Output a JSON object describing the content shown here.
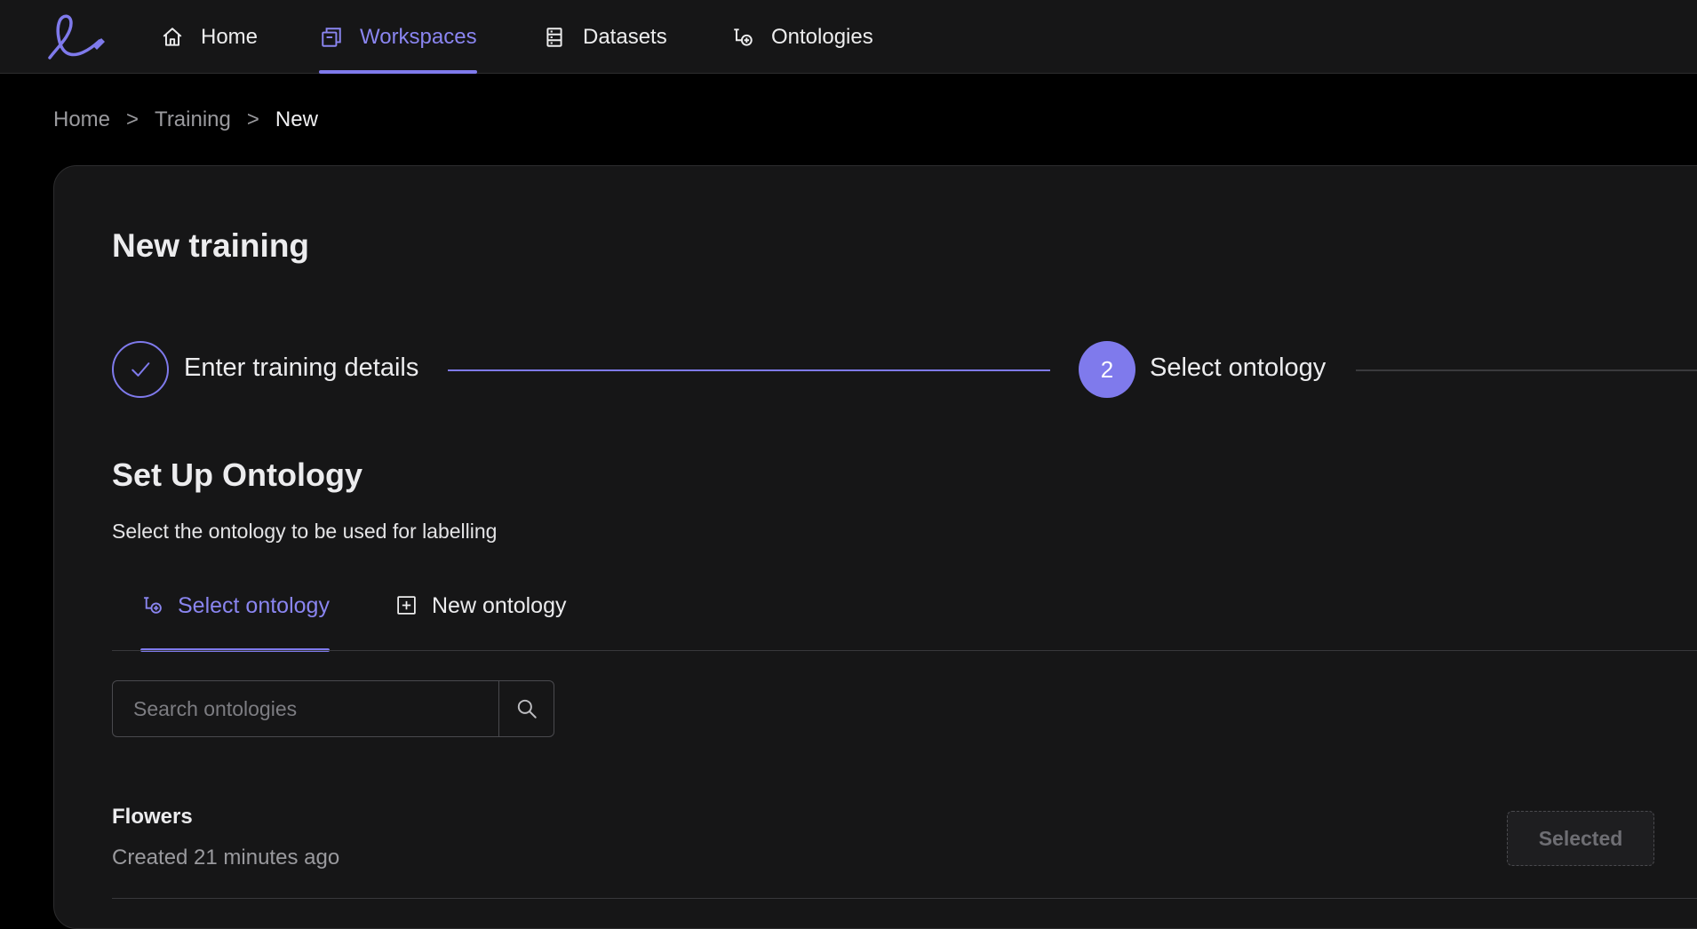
{
  "nav": {
    "items": [
      {
        "label": "Home",
        "icon": "home-icon",
        "active": false
      },
      {
        "label": "Workspaces",
        "icon": "workspaces-icon",
        "active": true
      },
      {
        "label": "Datasets",
        "icon": "datasets-icon",
        "active": false
      },
      {
        "label": "Ontologies",
        "icon": "ontologies-icon",
        "active": false
      }
    ]
  },
  "breadcrumb": {
    "items": [
      "Home",
      "Training",
      "New"
    ],
    "separator": ">"
  },
  "page": {
    "title": "New training"
  },
  "stepper": {
    "steps": [
      {
        "label": "Enter training details",
        "state": "done",
        "icon": "check-icon"
      },
      {
        "number": "2",
        "label": "Select ontology",
        "state": "active"
      }
    ]
  },
  "section": {
    "title": "Set Up Ontology",
    "subtitle": "Select the ontology to be used for labelling"
  },
  "tabs": [
    {
      "label": "Select ontology",
      "icon": "ontologies-icon",
      "active": true
    },
    {
      "label": "New ontology",
      "icon": "plus-square-icon",
      "active": false
    }
  ],
  "search": {
    "placeholder": "Search ontologies",
    "value": ""
  },
  "ontologies": [
    {
      "name": "Flowers",
      "meta": "Created 21 minutes ago",
      "action": "Selected"
    }
  ],
  "colors": {
    "accent": "#7f7aec",
    "accent_text": "#8a85f0",
    "panel": "#161617",
    "background": "#000000"
  }
}
